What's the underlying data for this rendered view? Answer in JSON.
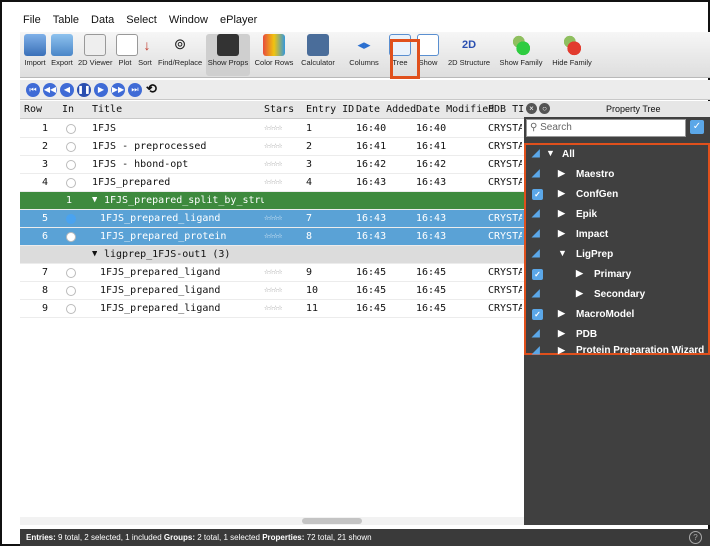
{
  "menu": [
    "File",
    "Table",
    "Data",
    "Select",
    "Window",
    "ePlayer"
  ],
  "toolbar": {
    "import": "Import",
    "export": "Export",
    "viewer": "2D Viewer",
    "plot": "Plot",
    "sort": "Sort",
    "find": "Find/Replace",
    "show_props": "Show Props",
    "color_rows": "Color Rows",
    "calculator": "Calculator",
    "columns": "Columns",
    "tree": "Tree",
    "show": "Show",
    "structure_2d": "2D Structure",
    "structure_icon": "2D",
    "show_family": "Show Family",
    "hide_family": "Hide Family"
  },
  "table": {
    "headers": [
      "Row",
      "In",
      "Title",
      "Stars",
      "Entry ID",
      "Date Added",
      "Date Modified",
      "PDB TITL"
    ],
    "rows": [
      {
        "row": "1",
        "title": "1FJS",
        "stars": "☆☆☆☆",
        "entry": "1",
        "added": "16:40",
        "modified": "16:40",
        "pdb": "CRYSTAL"
      },
      {
        "row": "2",
        "title": "1FJS - preprocessed",
        "stars": "☆☆☆☆",
        "entry": "2",
        "added": "16:41",
        "modified": "16:41",
        "pdb": "CRYSTAL"
      },
      {
        "row": "3",
        "title": "1FJS - hbond-opt",
        "stars": "☆☆☆☆",
        "entry": "3",
        "added": "16:42",
        "modified": "16:42",
        "pdb": "CRYSTAL"
      },
      {
        "row": "4",
        "title": "1FJS_prepared",
        "stars": "☆☆☆☆",
        "entry": "4",
        "added": "16:43",
        "modified": "16:43",
        "pdb": "CRYSTAL"
      },
      {
        "row": "1",
        "title": "1FJS_prepared_split_by_stru…",
        "stars": "",
        "entry": "",
        "added": "",
        "modified": "",
        "pdb": ""
      },
      {
        "row": "5",
        "title": "1FJS_prepared_ligand",
        "stars": "☆☆☆☆",
        "entry": "7",
        "added": "16:43",
        "modified": "16:43",
        "pdb": "CRYSTAL"
      },
      {
        "row": "6",
        "title": "1FJS_prepared_protein",
        "stars": "☆☆☆☆",
        "entry": "8",
        "added": "16:43",
        "modified": "16:43",
        "pdb": "CRYSTAL"
      },
      {
        "row": "",
        "title": "ligprep_1FJS-out1 (3)",
        "stars": "",
        "entry": "",
        "added": "",
        "modified": "",
        "pdb": ""
      },
      {
        "row": "7",
        "title": "1FJS_prepared_ligand",
        "stars": "☆☆☆☆",
        "entry": "9",
        "added": "16:45",
        "modified": "16:45",
        "pdb": "CRYSTAL"
      },
      {
        "row": "8",
        "title": "1FJS_prepared_ligand",
        "stars": "☆☆☆☆",
        "entry": "10",
        "added": "16:45",
        "modified": "16:45",
        "pdb": "CRYSTAL"
      },
      {
        "row": "9",
        "title": "1FJS_prepared_ligand",
        "stars": "☆☆☆☆",
        "entry": "11",
        "added": "16:45",
        "modified": "16:45",
        "pdb": "CRYSTAL"
      }
    ]
  },
  "property_tree": {
    "title": "Property Tree",
    "search_placeholder": "Search",
    "nodes": [
      "All",
      "Maestro",
      "ConfGen",
      "Epik",
      "Impact",
      "LigPrep",
      "Primary",
      "Secondary",
      "MacroModel",
      "PDB",
      "Protein Preparation Wizard"
    ]
  },
  "status": {
    "entries_label": "Entries:",
    "entries_text": "9 total, 2 selected, 1 included",
    "groups_label": "Groups:",
    "groups_text": "2 total, 1 selected",
    "props_label": "Properties:",
    "props_text": "72 total, 21 shown",
    "help": "?"
  },
  "colors": {
    "accent": "#e0501c",
    "selection": "#5aa2d6",
    "group_green": "#3e8a3e"
  }
}
